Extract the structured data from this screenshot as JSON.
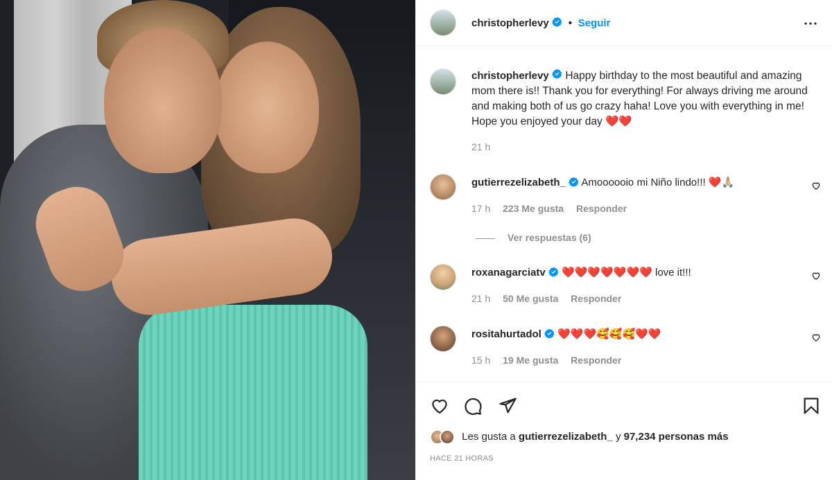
{
  "post": {
    "photo_alt": "photo",
    "author": "christopherlevy",
    "follow_label": "Seguir",
    "caption": "Happy birthday to the most beautiful and amazing mom there is!! Thank you for everything! For always driving me around and making both of us go crazy haha! Love you with everything in me! Hope you enjoyed your day ❤️❤️",
    "caption_time": "21 h"
  },
  "comments": [
    {
      "user": "gutierrezelizabeth_",
      "text": "Amoooooio mi Niño lindo!!! ❤️🙏🏼",
      "time": "17 h",
      "likes": "223 Me gusta",
      "reply": "Responder"
    },
    {
      "user": "roxanagarciatv",
      "text": "❤️❤️❤️❤️❤️❤️❤️ love it!!!",
      "time": "21 h",
      "likes": "50 Me gusta",
      "reply": "Responder"
    },
    {
      "user": "rositahurtadol",
      "text": "❤️❤️❤️🥰🥰🥰❤️❤️",
      "time": "15 h",
      "likes": "19 Me gusta",
      "reply": "Responder"
    }
  ],
  "view_replies": "Ver respuestas (6)",
  "likes_line": {
    "prefix": "Les gusta a",
    "user": "gutierrezelizabeth_",
    "joiner": "y",
    "count": "97,234 personas más"
  },
  "post_time": "HACE 21 HORAS",
  "colors": {
    "accent": "#0095f6",
    "text": "#262626",
    "muted": "#8e8e8e",
    "border": "#efefef"
  }
}
